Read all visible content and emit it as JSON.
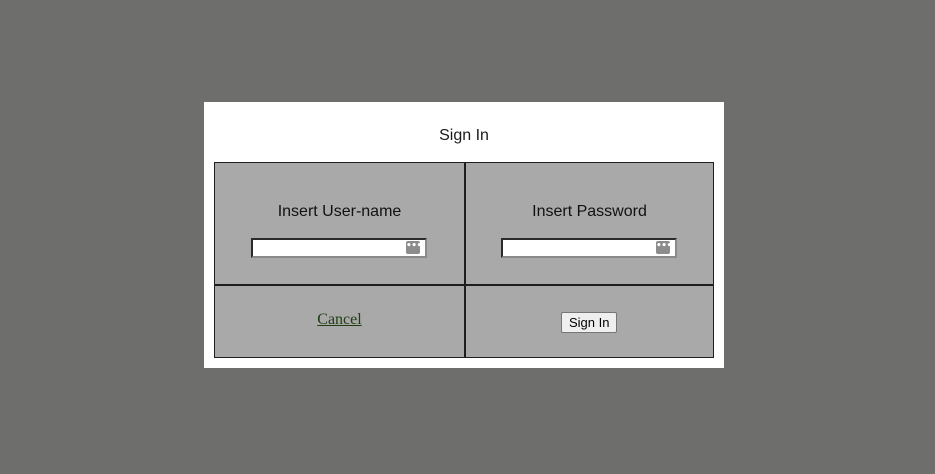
{
  "dialog": {
    "title": "Sign In"
  },
  "username": {
    "label": "Insert User-name",
    "value": "",
    "key_icon": "password-manager-icon"
  },
  "password": {
    "label": "Insert Password",
    "value": "",
    "key_icon": "password-manager-icon"
  },
  "actions": {
    "cancel_label": "Cancel",
    "signin_label": "Sign In"
  },
  "colors": {
    "backdrop": "#6e6e6c",
    "panel": "#ffffff",
    "cell_bg": "#a9a9a9",
    "link": "#1f3d10"
  }
}
